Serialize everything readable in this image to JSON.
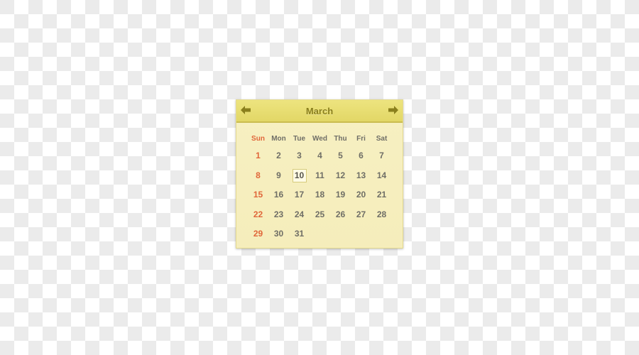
{
  "calendar": {
    "month": "March",
    "prev_icon": "arrow-left-icon",
    "next_icon": "arrow-right-icon",
    "weekdays": [
      "Sun",
      "Mon",
      "Tue",
      "Wed",
      "Thu",
      "Fri",
      "Sat"
    ],
    "days": [
      1,
      2,
      3,
      4,
      5,
      6,
      7,
      8,
      9,
      10,
      11,
      12,
      13,
      14,
      15,
      16,
      17,
      18,
      19,
      20,
      21,
      22,
      23,
      24,
      25,
      26,
      27,
      28,
      29,
      30,
      31
    ],
    "first_weekday_index": 0,
    "selected_day": 10,
    "colors": {
      "header_bg": "#e6dc70",
      "body_bg": "#f6eebe",
      "title": "#8a7f1c",
      "weekend": "#e0663a",
      "text": "#6f6e66"
    }
  }
}
